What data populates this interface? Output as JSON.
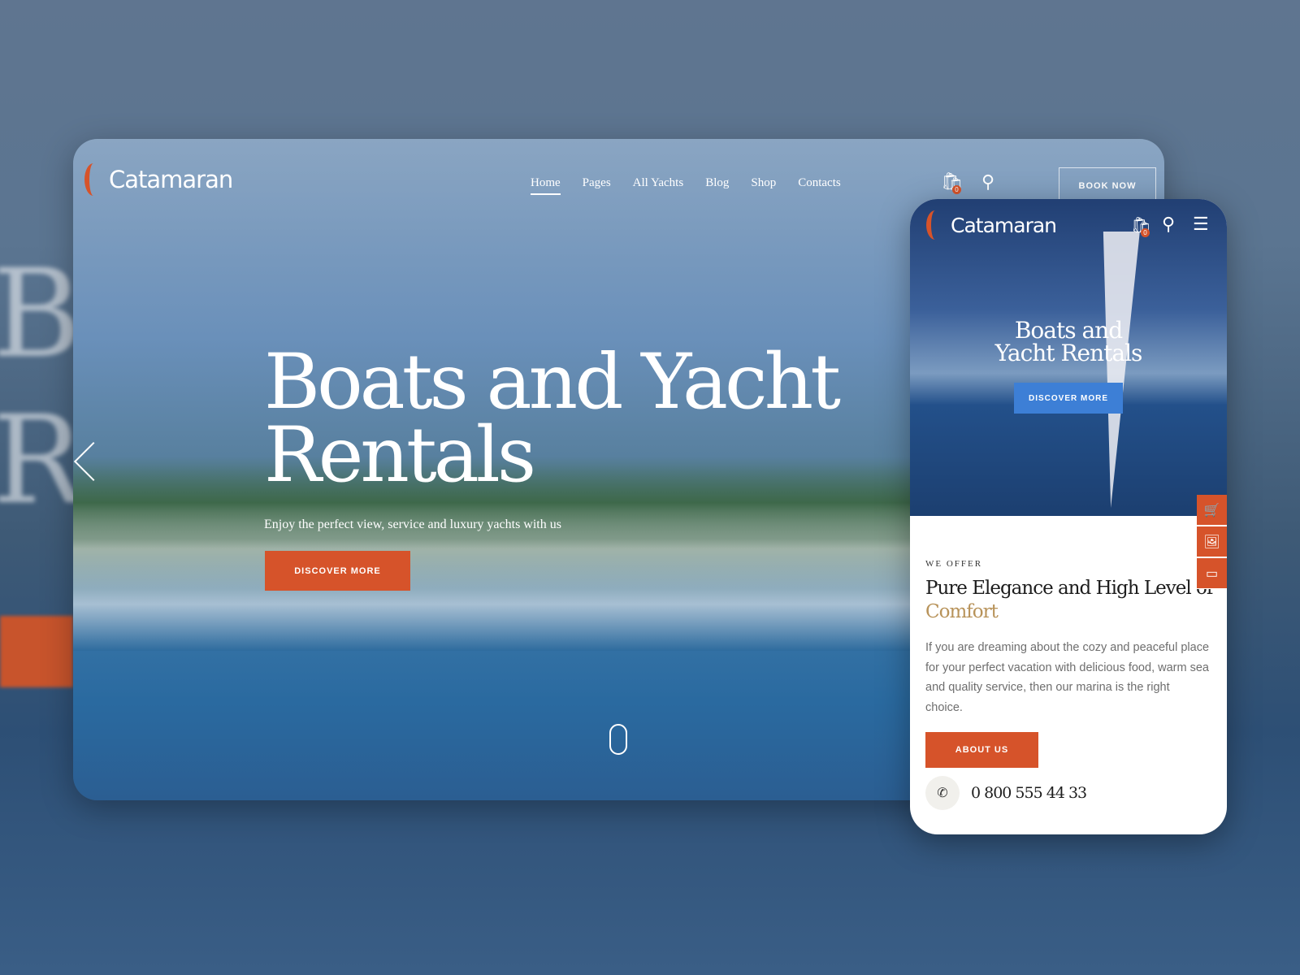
{
  "background": {
    "letters": [
      "B",
      "R"
    ]
  },
  "colors": {
    "accent": "#d6532a",
    "gold": "#b8935a"
  },
  "desktop": {
    "logo": "Catamaran",
    "nav": [
      "Home",
      "Pages",
      "All Yachts",
      "Blog",
      "Shop",
      "Contacts"
    ],
    "active_nav": "Home",
    "cart_count": "0",
    "book_now": "BOOK NOW",
    "hero_title_1": "Boats and Yacht",
    "hero_title_2": "Rentals",
    "hero_subtitle": "Enjoy the perfect view, service and luxury yachts with us",
    "cta": "DISCOVER MORE",
    "icons": [
      "cart-icon",
      "search-icon",
      "chevron-left-icon",
      "mouse-scroll-icon"
    ]
  },
  "mobile": {
    "logo": "Catamaran",
    "cart_count": "0",
    "hero_title": "Boats and Yacht Rentals",
    "cta": "DISCOVER MORE",
    "eyebrow": "WE OFFER",
    "title": "Pure Elegance and High Level of",
    "title_accent": "Comfort",
    "text": "If you are dreaming about the cozy and peaceful place for your perfect vacation with delicious food, warm sea and quality service, then our marina is the right choice.",
    "about": "ABOUT US",
    "phone": "0 800 555 44 33",
    "side_icons": [
      "cart-icon",
      "image-icon",
      "browser-icon"
    ]
  }
}
